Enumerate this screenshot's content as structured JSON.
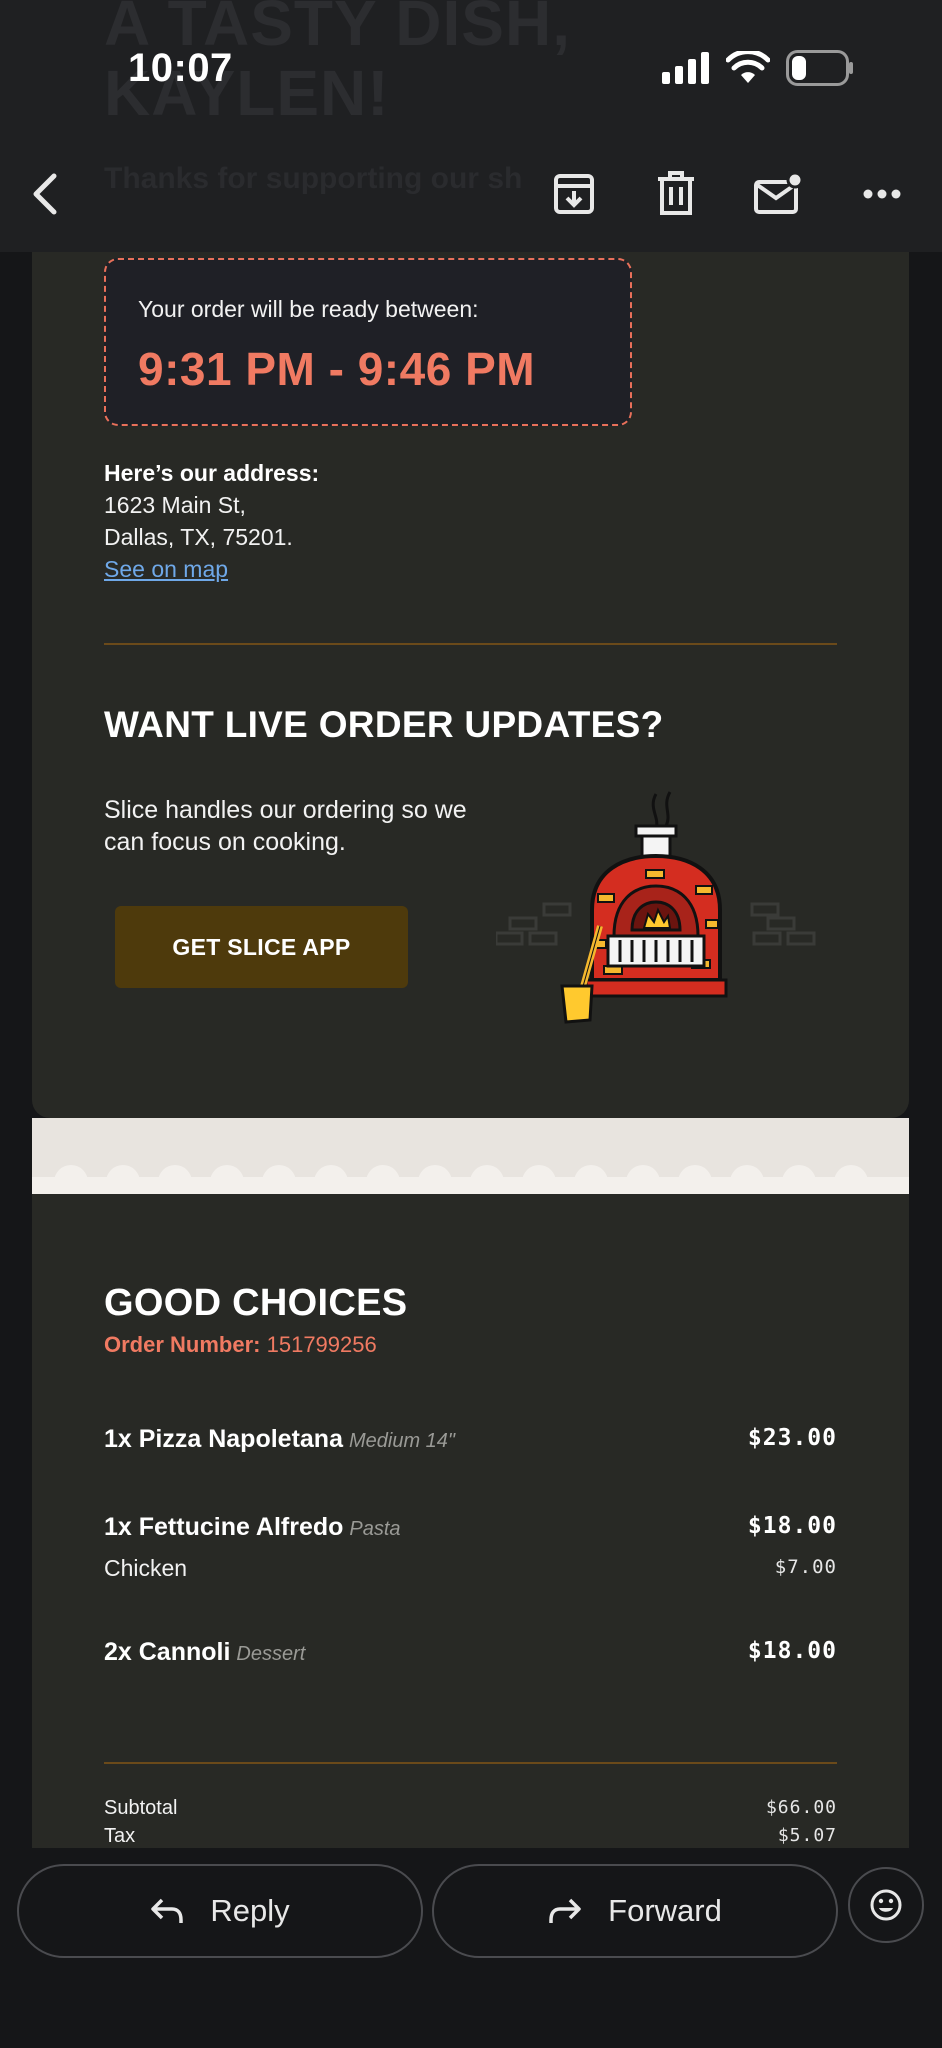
{
  "status_bar": {
    "time": "10:07"
  },
  "background_email_header": {
    "title": "A TASTY DISH,\nKAYLEN!",
    "subtitle": "Thanks for supporting our sh"
  },
  "toolbar": {
    "icons": [
      "back-icon",
      "archive-icon",
      "delete-icon",
      "mark-unread-icon",
      "more-icon"
    ]
  },
  "ready": {
    "label": "Your order will be ready between:",
    "time_range": "9:31 PM - 9:46 PM"
  },
  "address": {
    "heading": "Here’s our address:",
    "line1": "1623 Main St,",
    "line2": "Dallas, TX, 75201.",
    "map_link": "See on map"
  },
  "promo": {
    "title": "WANT LIVE ORDER UPDATES?",
    "text": "Slice handles our ordering so we can focus on cooking.",
    "button": "GET SLICE APP"
  },
  "order": {
    "restaurant": "GOOD CHOICES",
    "number_label": "Order Number:",
    "number": "151799256",
    "items": [
      {
        "name": "1x Pizza Napoletana",
        "note": "Medium 14\"",
        "price": "$23.00"
      },
      {
        "name": "1x Fettucine Alfredo",
        "note": "Pasta",
        "price": "$18.00",
        "addon": {
          "name": "Chicken",
          "price": "$7.00"
        }
      },
      {
        "name": "2x Cannoli",
        "note": "Dessert",
        "price": "$18.00"
      }
    ],
    "totals": [
      {
        "label": "Subtotal",
        "value": "$66.00"
      },
      {
        "label": "Tax",
        "value": "$5.07"
      }
    ]
  },
  "actions": {
    "reply": "Reply",
    "forward": "Forward"
  },
  "colors": {
    "accent": "#f07a62",
    "link": "#6fa8e8",
    "button_bg": "#4e3a0c",
    "card_bg": "#282925",
    "divider": "#6b4a1a"
  }
}
